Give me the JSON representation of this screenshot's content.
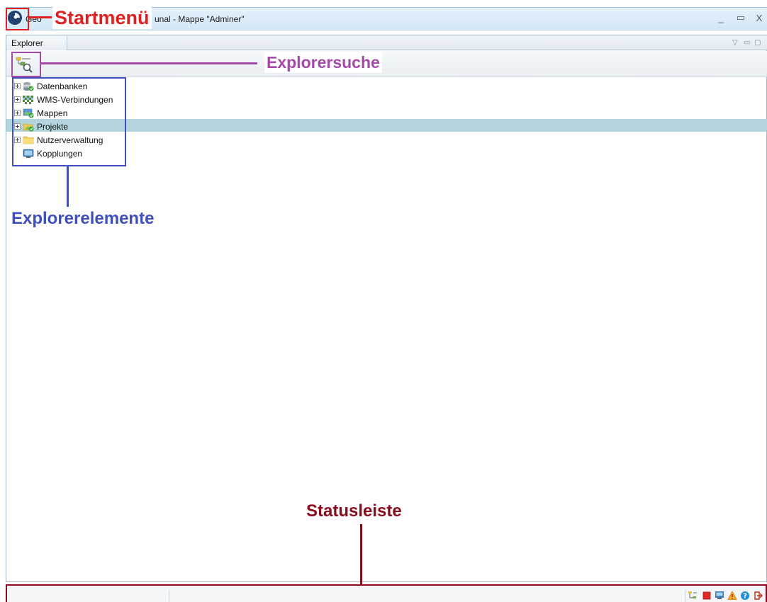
{
  "window": {
    "title_visible": "unal - Mappe \"Adminer\"",
    "title_prefix_visible": "Geo",
    "controls": {
      "minimize": "_",
      "maximize": "▭",
      "close": "X"
    }
  },
  "explorer": {
    "tab_label": "Explorer",
    "view_controls": [
      "▽",
      "▭",
      "▢"
    ],
    "search_button_icon": "explorer-search-icon",
    "tree": [
      {
        "label": "Datenbanken",
        "icon": "database-icon",
        "expandable": true,
        "selected": false
      },
      {
        "label": "WMS-Verbindungen",
        "icon": "wms-icon",
        "expandable": true,
        "selected": false
      },
      {
        "label": "Mappen",
        "icon": "maps-icon",
        "expandable": true,
        "selected": false
      },
      {
        "label": "Projekte",
        "icon": "project-icon",
        "expandable": true,
        "selected": true
      },
      {
        "label": "Nutzerverwaltung",
        "icon": "folder-icon",
        "expandable": true,
        "selected": false
      },
      {
        "label": "Kopplungen",
        "icon": "monitor-icon",
        "expandable": false,
        "selected": false
      }
    ]
  },
  "statusbar": {
    "icons": [
      "tree-icon",
      "stop-icon",
      "monitor-icon",
      "warning-icon",
      "help-icon",
      "exit-icon"
    ]
  },
  "annotations": {
    "startmenu": {
      "label": "Startmenü",
      "color": "#e02020"
    },
    "explorersearch": {
      "label": "Explorersuche",
      "color": "#a24aa6"
    },
    "explorerelements": {
      "label": "Explorerelemente",
      "color": "#3f4fbf"
    },
    "statusbar": {
      "label": "Statusleiste",
      "color": "#8b0a1c"
    }
  },
  "colors": {
    "selection": "#b2d4dc",
    "titlebar": "#d8eaf7"
  }
}
